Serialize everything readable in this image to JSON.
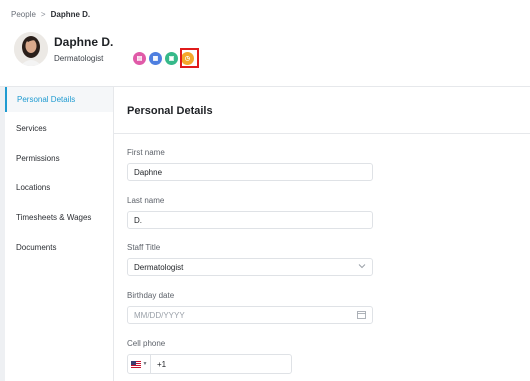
{
  "breadcrumb": {
    "parent": "People",
    "separator": ">",
    "current": "Daphne D."
  },
  "profile": {
    "name": "Daphne D.",
    "role": "Dermatologist",
    "badges": [
      {
        "icon": "chat-icon",
        "glyph": "▤",
        "color": "#e05aa8"
      },
      {
        "icon": "calendar-icon",
        "glyph": "▦",
        "color": "#4e7fe0"
      },
      {
        "icon": "service-icon",
        "glyph": "▣",
        "color": "#36b98a"
      },
      {
        "icon": "clock-icon",
        "glyph": "◷",
        "color": "#f4a82b"
      }
    ]
  },
  "sidebar": {
    "items": [
      {
        "label": "Personal Details",
        "active": true
      },
      {
        "label": "Services",
        "active": false
      },
      {
        "label": "Permissions",
        "active": false
      },
      {
        "label": "Locations",
        "active": false
      },
      {
        "label": "Timesheets & Wages",
        "active": false
      },
      {
        "label": "Documents",
        "active": false
      }
    ]
  },
  "main": {
    "title": "Personal Details",
    "first_name": {
      "label": "First name",
      "value": "Daphne"
    },
    "last_name": {
      "label": "Last name",
      "value": "D."
    },
    "staff_title": {
      "label": "Staff Title",
      "value": "Dermatologist"
    },
    "birthday": {
      "label": "Birthday date",
      "placeholder": "MM/DD/YYYY"
    },
    "cell_phone": {
      "label": "Cell phone",
      "country_code": "+1"
    }
  },
  "colors": {
    "accent": "#1f9bd1",
    "highlight": "#e01b1b"
  }
}
